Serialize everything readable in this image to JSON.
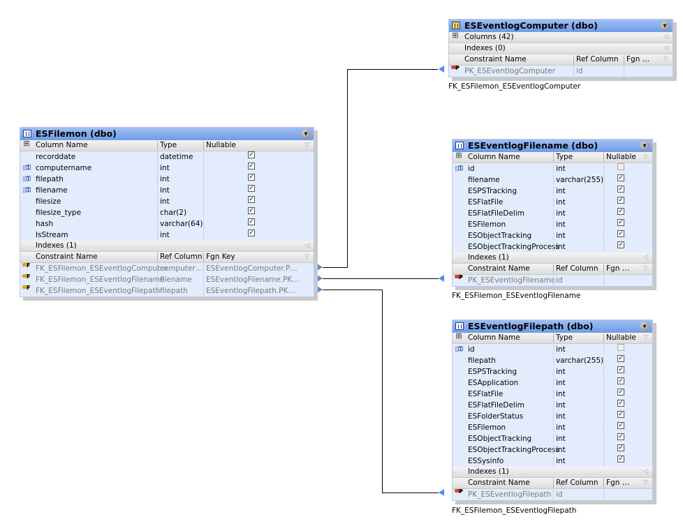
{
  "tables": [
    {
      "id": "esfilemon",
      "title": "ESFilemon (dbo)",
      "icon": "table-icon",
      "headers": [
        "Column Name",
        "Type",
        "Nullable"
      ],
      "columns": [
        {
          "name": "recorddate",
          "type": "datetime",
          "nullable": true,
          "fk": false
        },
        {
          "name": "computername",
          "type": "int",
          "nullable": true,
          "fk": true
        },
        {
          "name": "filepath",
          "type": "int",
          "nullable": true,
          "fk": true
        },
        {
          "name": "filename",
          "type": "int",
          "nullable": true,
          "fk": true
        },
        {
          "name": "filesize",
          "type": "int",
          "nullable": true,
          "fk": false
        },
        {
          "name": "filesize_type",
          "type": "char(2)",
          "nullable": true,
          "fk": false
        },
        {
          "name": "hash",
          "type": "varchar(64)",
          "nullable": true,
          "fk": false
        },
        {
          "name": "IsStream",
          "type": "int",
          "nullable": true,
          "fk": false
        }
      ],
      "indexes": "Indexes (1)",
      "constraint_headers": [
        "Constraint Name",
        "Ref Column",
        "Fgn Key"
      ],
      "constraints": [
        {
          "name": "FK_ESFilemon_ESEventlogComputer",
          "ref": "computer…",
          "fgn": "ESEventlogComputer.P…",
          "kind": "F"
        },
        {
          "name": "FK_ESFilemon_ESEventlogFilename",
          "ref": "filename",
          "fgn": "ESEventlogFilename.PK…",
          "kind": "F"
        },
        {
          "name": "FK_ESFilemon_ESEventlogFilepath",
          "ref": "filepath",
          "fgn": "ESEventlogFilepath.PK…",
          "kind": "F"
        }
      ]
    },
    {
      "id": "computer",
      "title": "ESEventlogComputer (dbo)",
      "icon": "view-table-icon",
      "collapsed_columns": "Columns (42)",
      "indexes": "Indexes (0)",
      "constraint_headers": [
        "Constraint Name",
        "Ref Column",
        "Fgn …"
      ],
      "constraints": [
        {
          "name": "PK_ESEventlogComputer",
          "ref": "id",
          "fgn": "",
          "kind": "P"
        }
      ],
      "relation_label": "FK_ESFilemon_ESEventlogComputer"
    },
    {
      "id": "filename",
      "title": "ESEventlogFilename (dbo)",
      "icon": "table-icon",
      "headers": [
        "Column Name",
        "Type",
        "Nullable"
      ],
      "columns": [
        {
          "name": "id",
          "type": "int",
          "nullable": false,
          "fk": true
        },
        {
          "name": "filename",
          "type": "varchar(255)",
          "nullable": true,
          "fk": false
        },
        {
          "name": "ESPSTracking",
          "type": "int",
          "nullable": true,
          "fk": false
        },
        {
          "name": "ESFlatFile",
          "type": "int",
          "nullable": true,
          "fk": false
        },
        {
          "name": "ESFlatFileDelim",
          "type": "int",
          "nullable": true,
          "fk": false
        },
        {
          "name": "ESFilemon",
          "type": "int",
          "nullable": true,
          "fk": false
        },
        {
          "name": "ESObjectTracking",
          "type": "int",
          "nullable": true,
          "fk": false
        },
        {
          "name": "ESObjectTrackingProcess",
          "type": "int",
          "nullable": true,
          "fk": false
        }
      ],
      "indexes": "Indexes (1)",
      "constraint_headers": [
        "Constraint Name",
        "Ref Column",
        "Fgn …"
      ],
      "constraints": [
        {
          "name": "PK_ESEventlogFilename",
          "ref": "id",
          "fgn": "",
          "kind": "P"
        }
      ],
      "relation_label": "FK_ESFilemon_ESEventlogFilename"
    },
    {
      "id": "filepath",
      "title": "ESEventlogFilepath (dbo)",
      "icon": "table-icon",
      "headers": [
        "Column Name",
        "Type",
        "Nullable"
      ],
      "columns": [
        {
          "name": "id",
          "type": "int",
          "nullable": false,
          "fk": true
        },
        {
          "name": "filepath",
          "type": "varchar(255)",
          "nullable": true,
          "fk": false
        },
        {
          "name": "ESPSTracking",
          "type": "int",
          "nullable": true,
          "fk": false
        },
        {
          "name": "ESApplication",
          "type": "int",
          "nullable": true,
          "fk": false
        },
        {
          "name": "ESFlatFile",
          "type": "int",
          "nullable": true,
          "fk": false
        },
        {
          "name": "ESFlatFileDelim",
          "type": "int",
          "nullable": true,
          "fk": false
        },
        {
          "name": "ESFolderStatus",
          "type": "int",
          "nullable": true,
          "fk": false
        },
        {
          "name": "ESFilemon",
          "type": "int",
          "nullable": true,
          "fk": false
        },
        {
          "name": "ESObjectTracking",
          "type": "int",
          "nullable": true,
          "fk": false
        },
        {
          "name": "ESObjectTrackingProcess",
          "type": "int",
          "nullable": true,
          "fk": false
        },
        {
          "name": "ESSysinfo",
          "type": "int",
          "nullable": true,
          "fk": false
        }
      ],
      "indexes": "Indexes (1)",
      "constraint_headers": [
        "Constraint Name",
        "Ref Column",
        "Fgn …"
      ],
      "constraints": [
        {
          "name": "PK_ESEventlogFilepath",
          "ref": "id",
          "fgn": "",
          "kind": "P"
        }
      ],
      "relation_label": "FK_ESFilemon_ESEventlogFilepath"
    }
  ],
  "colors": {
    "title": "#7aa3ea",
    "body": "#e3ecfc",
    "arrow": "#4a90e2"
  }
}
